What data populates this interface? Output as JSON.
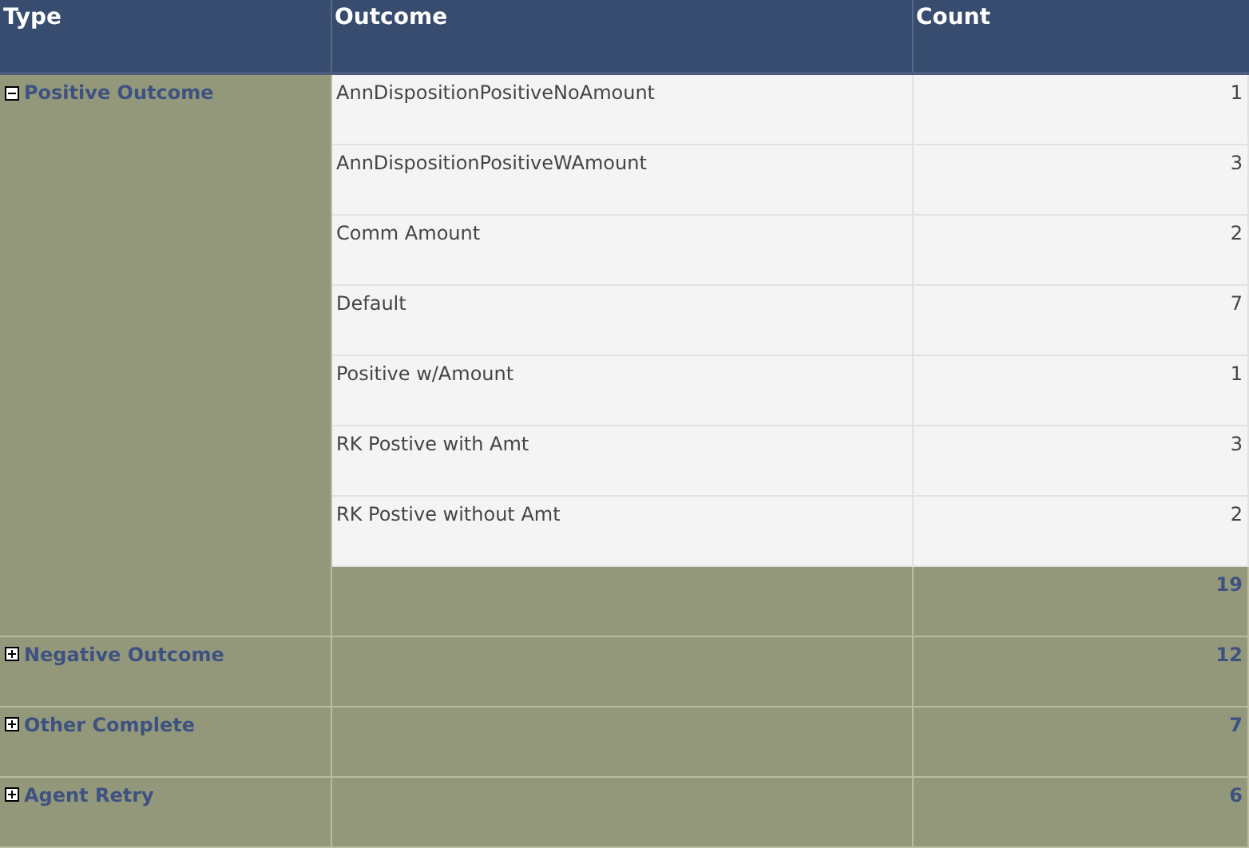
{
  "table": {
    "columns": [
      "Type",
      "Outcome",
      "Count"
    ],
    "groups": [
      {
        "type": "Positive Outcome",
        "expanded": true,
        "total": "19",
        "rows": [
          {
            "outcome": "AnnDispositionPositiveNoAmount",
            "count": "1"
          },
          {
            "outcome": "AnnDispositionPositiveWAmount",
            "count": "3"
          },
          {
            "outcome": "Comm Amount",
            "count": "2"
          },
          {
            "outcome": "Default",
            "count": "7"
          },
          {
            "outcome": "Positive w/Amount",
            "count": "1"
          },
          {
            "outcome": "RK Postive with Amt",
            "count": "3"
          },
          {
            "outcome": "RK Postive without Amt",
            "count": "2"
          }
        ]
      },
      {
        "type": "Negative Outcome",
        "expanded": false,
        "total": "12"
      },
      {
        "type": "Other Complete",
        "expanded": false,
        "total": "7"
      },
      {
        "type": "Agent Retry",
        "expanded": false,
        "total": "6"
      }
    ]
  }
}
